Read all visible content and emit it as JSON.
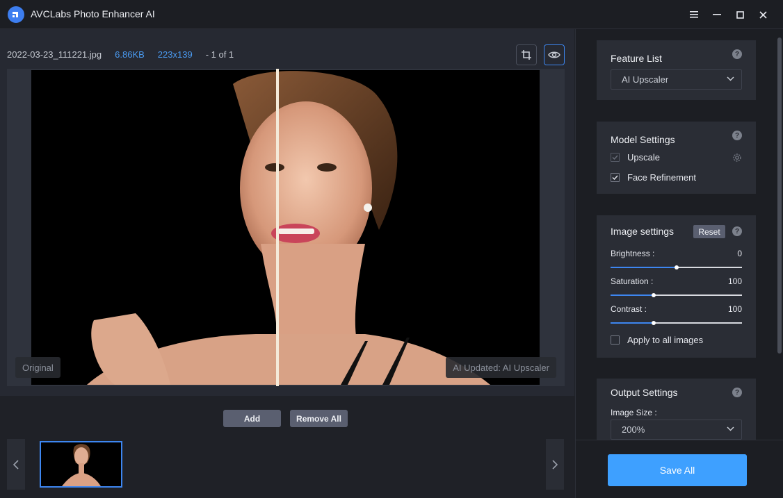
{
  "app": {
    "title": "AVCLabs Photo Enhancer AI"
  },
  "file": {
    "name": "2022-03-23_111221.jpg",
    "size": "6.86KB",
    "dimensions": "223x139",
    "count": "- 1 of 1"
  },
  "viewer": {
    "original_tag": "Original",
    "updated_tag": "AI Updated: AI Upscaler"
  },
  "actions": {
    "add": "Add",
    "remove_all": "Remove All"
  },
  "feature_list": {
    "title": "Feature List",
    "selected": "AI Upscaler"
  },
  "model_settings": {
    "title": "Model Settings",
    "upscale": "Upscale",
    "face_refinement": "Face Refinement"
  },
  "image_settings": {
    "title": "Image settings",
    "reset": "Reset",
    "brightness_label": "Brightness :",
    "brightness_value": "0",
    "saturation_label": "Saturation :",
    "saturation_value": "100",
    "contrast_label": "Contrast :",
    "contrast_value": "100",
    "apply_all": "Apply to all images"
  },
  "slider_levels": {
    "brightness": 0.5,
    "saturation": 0.33,
    "contrast": 0.33
  },
  "output_settings": {
    "title": "Output Settings",
    "image_size_label": "Image Size :",
    "image_size": "200%"
  },
  "save": {
    "label": "Save All"
  },
  "help_glyph": "?",
  "colors": {
    "accent": "#3d86f0",
    "save": "#3ea0ff",
    "link": "#4a9af0"
  }
}
